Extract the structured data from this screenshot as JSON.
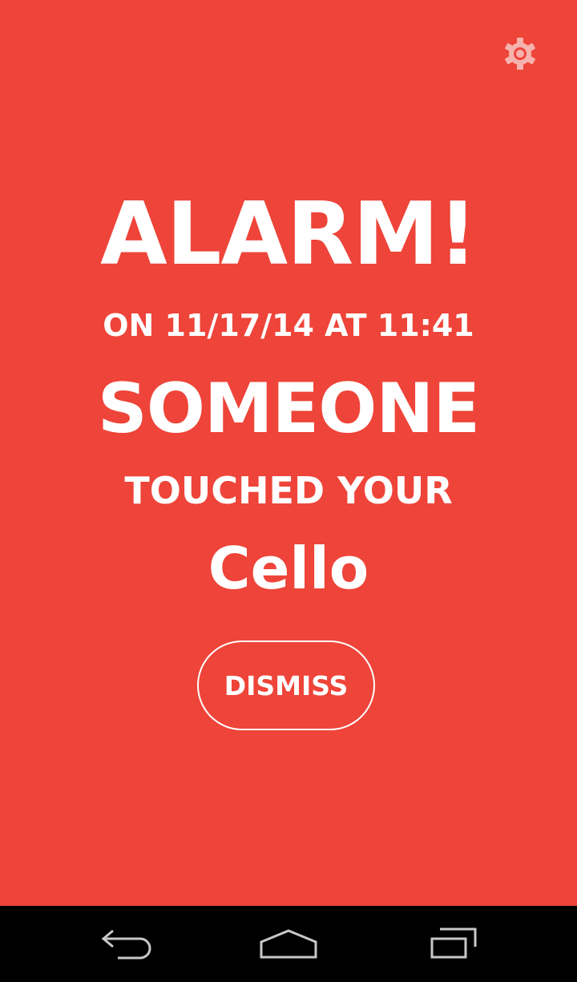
{
  "colors": {
    "background": "#ee4439",
    "text": "#ffffff",
    "navbar": "#000000",
    "nav_icon": "#c8c8c8"
  },
  "header": {
    "settings_icon": "gear-icon"
  },
  "alarm": {
    "title": "ALARM!",
    "datetime": "ON 11/17/14 AT 11:41",
    "subject": "SOMEONE",
    "action": "TOUCHED YOUR",
    "object": "Cello"
  },
  "dismiss": {
    "label": "DISMISS"
  },
  "navbar": {
    "back_icon": "back-arrow-icon",
    "home_icon": "home-icon",
    "recent_icon": "recent-apps-icon"
  }
}
